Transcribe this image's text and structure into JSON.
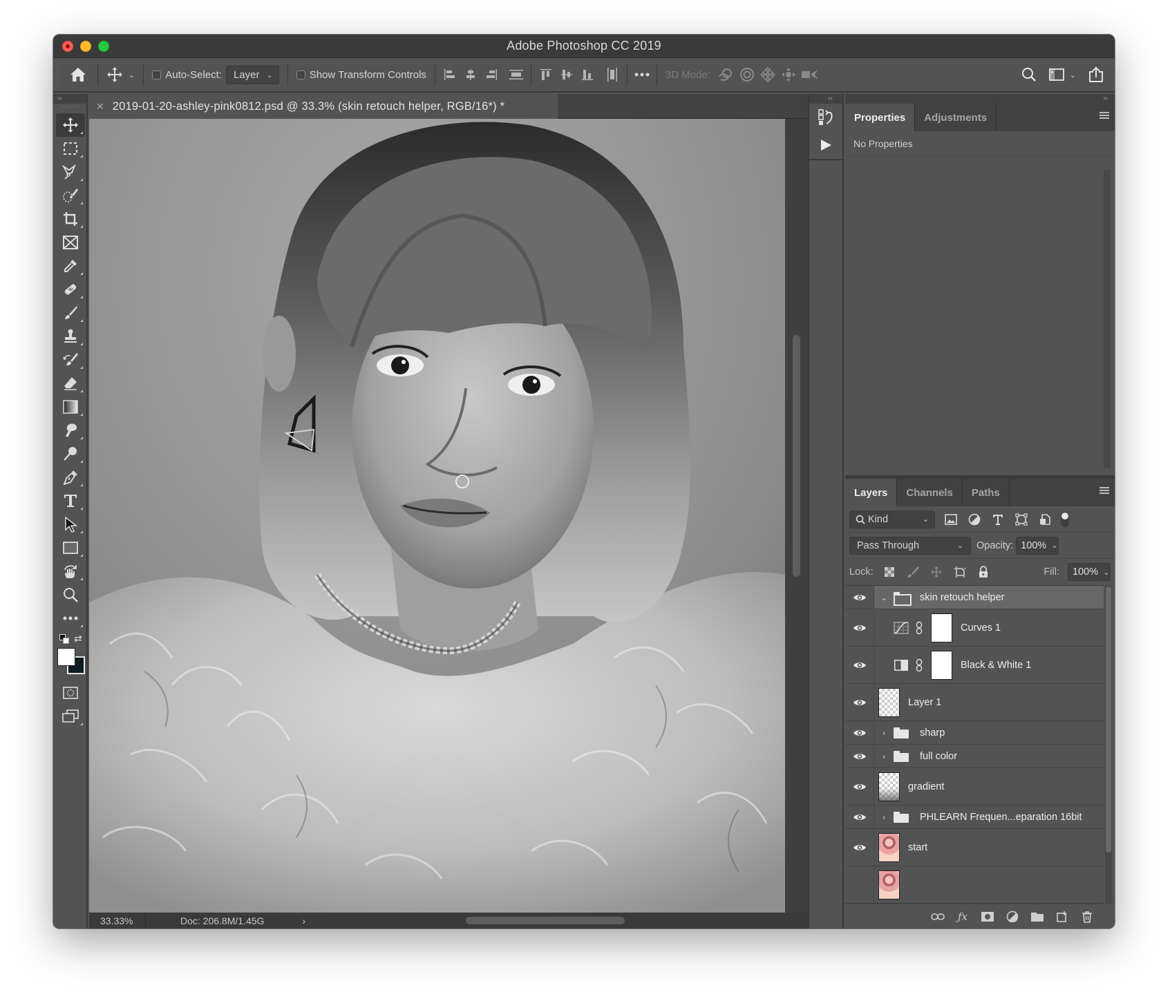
{
  "window": {
    "title": "Adobe Photoshop CC 2019",
    "traffic_lights": {
      "close": "#fe5f57",
      "minimize": "#febc2e",
      "maximize": "#28c840"
    }
  },
  "options_bar": {
    "home_icon": "home-icon",
    "tool_preset_icon": "move-icon",
    "auto_select_label": "Auto-Select:",
    "auto_select_checked": false,
    "auto_select_target": "Layer",
    "show_transform_label": "Show Transform Controls",
    "show_transform_checked": false,
    "align_icons": [
      "align-left-edges-icon",
      "align-horizontal-centers-icon",
      "align-right-edges-icon",
      "distribute-vertical-icon",
      "align-top-edges-icon",
      "align-vertical-centers-icon",
      "align-bottom-edges-icon",
      "distribute-horizontal-icon"
    ],
    "more_icon": "more-icon",
    "mode_3d_label": "3D Mode:",
    "mode_3d_icons": [
      "orbit-3d-icon",
      "roll-3d-icon",
      "drag-3d-icon",
      "slide-3d-icon",
      "scale-3d-icon"
    ],
    "right_icons": [
      "search-icon",
      "workspace-icon",
      "share-icon"
    ]
  },
  "panel_collapse": {
    "left": "››",
    "mini_dock": "‹‹",
    "right": "››"
  },
  "document": {
    "tab_title": "2019-01-20-ashley-pink0812.psd @ 33.3% (skin retouch helper, RGB/16*) *",
    "zoom": "33.33%",
    "doc_size": "Doc: 206.8M/1.45G",
    "status_arrow": "›"
  },
  "tools": [
    {
      "name": "move-tool",
      "icon": "move-icon",
      "active": true
    },
    {
      "name": "marquee-tool",
      "icon": "rectangular-marquee-icon"
    },
    {
      "name": "lasso-tool",
      "icon": "polygonal-lasso-icon"
    },
    {
      "name": "quick-selection-tool",
      "icon": "quick-selection-icon"
    },
    {
      "name": "crop-tool",
      "icon": "crop-icon"
    },
    {
      "name": "frame-tool",
      "icon": "frame-icon"
    },
    {
      "name": "eyedropper-tool",
      "icon": "eyedropper-icon"
    },
    {
      "name": "healing-brush-tool",
      "icon": "bandage-icon"
    },
    {
      "name": "brush-tool",
      "icon": "brush-icon"
    },
    {
      "name": "clone-stamp-tool",
      "icon": "stamp-icon"
    },
    {
      "name": "history-brush-tool",
      "icon": "history-brush-icon"
    },
    {
      "name": "eraser-tool",
      "icon": "eraser-icon"
    },
    {
      "name": "gradient-tool",
      "icon": "gradient-icon"
    },
    {
      "name": "smudge-tool",
      "icon": "smudge-icon"
    },
    {
      "name": "dodge-tool",
      "icon": "dodge-icon"
    },
    {
      "name": "pen-tool",
      "icon": "pen-icon"
    },
    {
      "name": "type-tool",
      "icon": "type-icon"
    },
    {
      "name": "path-selection-tool",
      "icon": "arrow-icon"
    },
    {
      "name": "rectangle-tool",
      "icon": "rectangle-icon"
    },
    {
      "name": "hand-tool",
      "icon": "rotate-view-icon"
    },
    {
      "name": "zoom-tool",
      "icon": "zoom-icon"
    },
    {
      "name": "edit-toolbar",
      "icon": "more-icon"
    }
  ],
  "colors": {
    "foreground": "#ffffff",
    "background": "#0e1c22"
  },
  "mini_dock": {
    "buttons": [
      "history-icon",
      "actions-play-icon"
    ]
  },
  "properties_panel": {
    "tabs": [
      {
        "label": "Properties",
        "active": true
      },
      {
        "label": "Adjustments",
        "active": false
      }
    ],
    "content": "No Properties"
  },
  "layers_panel": {
    "tabs": [
      {
        "label": "Layers",
        "active": true
      },
      {
        "label": "Channels",
        "active": false
      },
      {
        "label": "Paths",
        "active": false
      }
    ],
    "filter_kind": "Kind",
    "filter_icons": [
      "pixel-filter-icon",
      "adjustment-filter-icon",
      "type-filter-icon",
      "shape-filter-icon",
      "smart-object-filter-icon"
    ],
    "blend_mode": "Pass Through",
    "opacity_label": "Opacity:",
    "opacity": "100%",
    "lock_label": "Lock:",
    "lock_icons": [
      "lock-transparent-icon",
      "lock-image-icon",
      "lock-position-icon",
      "lock-artboard-icon",
      "lock-all-icon"
    ],
    "fill_label": "Fill:",
    "fill": "100%",
    "layers": [
      {
        "name": "skin retouch helper",
        "type": "group",
        "expanded": true,
        "selected": true,
        "visible": true
      },
      {
        "name": "Curves 1",
        "type": "adjustment",
        "adjustment": "curves",
        "indent": true,
        "visible": true
      },
      {
        "name": "Black & White 1",
        "type": "adjustment",
        "adjustment": "black-white",
        "indent": true,
        "visible": true
      },
      {
        "name": "Layer 1",
        "type": "pixel",
        "thumb": "transparent",
        "visible": true
      },
      {
        "name": "sharp",
        "type": "group",
        "expanded": false,
        "visible": true
      },
      {
        "name": "full color",
        "type": "group",
        "expanded": false,
        "visible": true
      },
      {
        "name": "gradient",
        "type": "pixel",
        "thumb": "gradient",
        "visible": true
      },
      {
        "name": "PHLEARN Frequen...eparation 16bit",
        "type": "group",
        "expanded": false,
        "visible": true
      },
      {
        "name": "start",
        "type": "pixel",
        "thumb": "photo",
        "visible": true
      },
      {
        "name": "",
        "type": "pixel",
        "thumb": "photo",
        "visible": true
      }
    ],
    "footer_icons": [
      "link-layers-icon",
      "fx-icon",
      "add-mask-icon",
      "adjustment-layer-icon",
      "new-group-icon",
      "new-layer-icon",
      "trash-icon"
    ]
  }
}
